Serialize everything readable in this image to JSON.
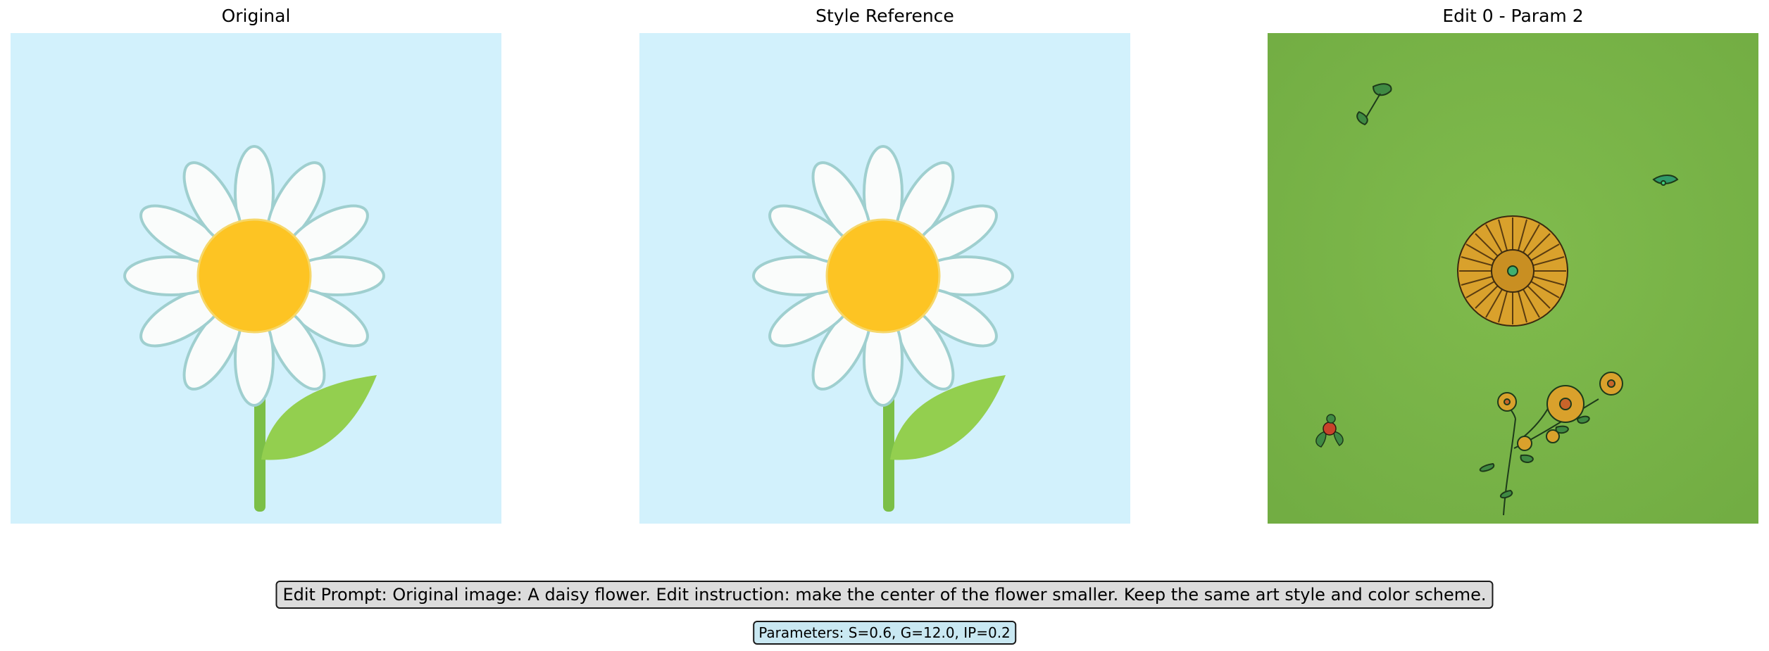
{
  "panels": [
    {
      "title": "Original",
      "image": "daisy-flower-illustration"
    },
    {
      "title": "Style Reference",
      "image": "daisy-flower-illustration"
    },
    {
      "title": "Edit 0 - Param 2",
      "image": "marigold-flowers-on-grass"
    }
  ],
  "edit_prompt": "Edit Prompt: Original image: A daisy flower. Edit instruction: make the center of the flower smaller. Keep the same art style and color scheme.",
  "parameters": "Parameters: S=0.6, G=12.0, IP=0.2",
  "colors": {
    "sky_background": "#d2f1fc",
    "petal_fill": "#fafcfb",
    "petal_outline": "#9fcfcf",
    "flower_center": "#fdc423",
    "stem": "#7bbf47",
    "leaf": "#93cf4f",
    "grass": "#7cb74a",
    "marigold": "#d9a12c",
    "prompt_box": "#dcdcdc",
    "params_box": "#c9e8f2"
  }
}
